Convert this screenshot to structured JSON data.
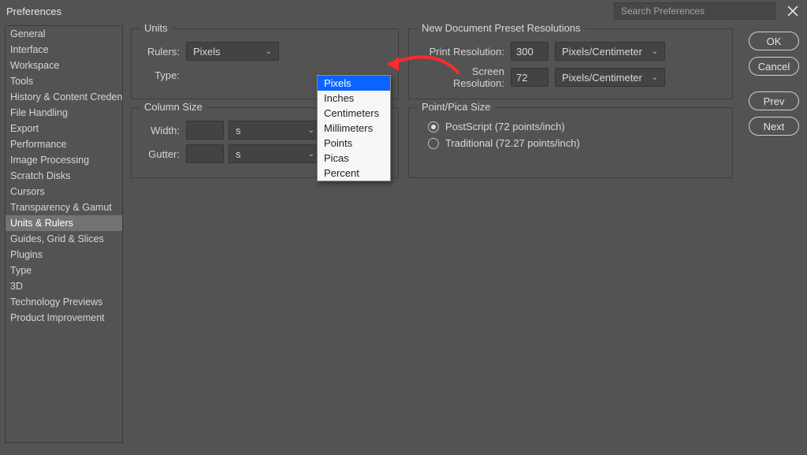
{
  "title": "Preferences",
  "search_placeholder": "Search Preferences",
  "sidebar": {
    "items": [
      "General",
      "Interface",
      "Workspace",
      "Tools",
      "History & Content Credentials",
      "File Handling",
      "Export",
      "Performance",
      "Image Processing",
      "Scratch Disks",
      "Cursors",
      "Transparency & Gamut",
      "Units & Rulers",
      "Guides, Grid & Slices",
      "Plugins",
      "Type",
      "3D",
      "Technology Previews",
      "Product Improvement"
    ],
    "active_index": 12
  },
  "units": {
    "section_title": "Units",
    "rulers_label": "Rulers:",
    "rulers_value": "Pixels",
    "type_label": "Type:",
    "type_value": "",
    "dropdown_options": [
      "Pixels",
      "Inches",
      "Centimeters",
      "Millimeters",
      "Points",
      "Picas",
      "Percent"
    ],
    "dropdown_selected_index": 0
  },
  "columns": {
    "section_title": "Column Size",
    "width_label": "Width:",
    "width_unit": "Points",
    "gutter_label": "Gutter:",
    "gutter_unit": "Points"
  },
  "resolutions": {
    "section_title": "New Document Preset Resolutions",
    "print_label": "Print Resolution:",
    "print_value": "300",
    "print_unit": "Pixels/Centimeter",
    "screen_label": "Screen Resolution:",
    "screen_value": "72",
    "screen_unit": "Pixels/Centimeter"
  },
  "pointpica": {
    "section_title": "Point/Pica Size",
    "opt1": "PostScript (72 points/inch)",
    "opt2": "Traditional (72.27 points/inch)",
    "selected": 0
  },
  "buttons": {
    "ok": "OK",
    "cancel": "Cancel",
    "prev": "Prev",
    "next": "Next"
  }
}
